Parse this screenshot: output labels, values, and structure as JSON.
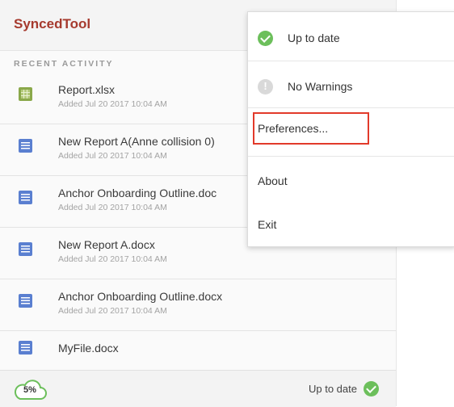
{
  "app": {
    "title": "SyncedTool"
  },
  "activity": {
    "section_label": "RECENT ACTIVITY",
    "items": [
      {
        "name": "Report.xlsx",
        "meta": "Added Jul 20 2017 10:04 AM",
        "icon": "xlsx-file-icon"
      },
      {
        "name": "New Report A(Anne collision 0)",
        "meta": "Added Jul 20 2017 10:04 AM",
        "icon": "docx-file-icon"
      },
      {
        "name": "Anchor Onboarding Outline.doc",
        "meta": "Added Jul 20 2017 10:04 AM",
        "icon": "docx-file-icon"
      },
      {
        "name": "New Report A.docx",
        "meta": "Added Jul 20 2017 10:04 AM",
        "icon": "docx-file-icon"
      },
      {
        "name": "Anchor Onboarding Outline.docx",
        "meta": "Added Jul 20 2017 10:04 AM",
        "icon": "docx-file-icon"
      },
      {
        "name": "MyFile.docx",
        "meta": "",
        "icon": "docx-file-icon"
      }
    ]
  },
  "footer": {
    "progress_label": "5%",
    "status": "Up to date"
  },
  "menu": {
    "status_label": "Up to date",
    "warnings_label": "No Warnings",
    "preferences_label": "Preferences...",
    "about_label": "About",
    "exit_label": "Exit"
  },
  "colors": {
    "brand": "#a63a2e",
    "success": "#6cbf5b",
    "highlight": "#e23a2a",
    "doc_icon": "#5a7fd0",
    "xlsx_icon": "#8aa84a"
  }
}
